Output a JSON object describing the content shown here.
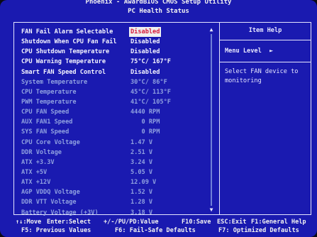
{
  "header": {
    "title": "Phoenix - AwardBIOS CMOS Setup Utility",
    "subtitle": "PC Health Status"
  },
  "settings": [
    {
      "label": "FAN Fail Alarm Selectable",
      "value": "Disabled",
      "editable": true,
      "selected": true
    },
    {
      "label": "Shutdown When CPU Fan Fail",
      "value": "Disabled",
      "editable": true
    },
    {
      "label": "CPU Shutdown Temperature",
      "value": "Disabled",
      "editable": true
    },
    {
      "label": "CPU Warning Temperature",
      "value": "75°C/ 167°F",
      "editable": true
    },
    {
      "label": "Smart FAN Speed Control",
      "value": "Disabled",
      "editable": true
    },
    {
      "label": "System Temperature",
      "value": "30°C/  86°F",
      "editable": false
    },
    {
      "label": "CPU Temperature",
      "value": "45°C/ 113°F",
      "editable": false
    },
    {
      "label": "PWM Temperature",
      "value": "41°C/ 105°F",
      "editable": false
    },
    {
      "label": "CPU FAN Speed",
      "value": "4440 RPM",
      "editable": false
    },
    {
      "label": "AUX FAN1 Speed",
      "value": "   0 RPM",
      "editable": false
    },
    {
      "label": "SYS FAN Speed",
      "value": "   0 RPM",
      "editable": false
    },
    {
      "label": "CPU Core Voltage",
      "value": "1.47 V",
      "editable": false
    },
    {
      "label": "DDR Voltage",
      "value": "2.51 V",
      "editable": false
    },
    {
      "label": "ATX +3.3V",
      "value": "3.24 V",
      "editable": false
    },
    {
      "label": "ATX +5V",
      "value": "5.05 V",
      "editable": false
    },
    {
      "label": "ATX +12V",
      "value": "12.09 V",
      "editable": false
    },
    {
      "label": "AGP VDDQ Voltage",
      "value": "1.52 V",
      "editable": false
    },
    {
      "label": "DDR VTT Voltage",
      "value": "1.28 V",
      "editable": false
    },
    {
      "label": "Battery Voltage (+3V)",
      "value": "3.18 V",
      "editable": false
    }
  ],
  "help": {
    "title": "Item Help",
    "menu_level": "Menu Level",
    "menu_level_arrow": "►",
    "text": "Select FAN device to monitoring"
  },
  "scroll": {
    "up": "▲",
    "down": "▼"
  },
  "keys": {
    "line1": [
      "↑↓:Move",
      "Enter:Select",
      "+/-/PU/PD:Value",
      "F10:Save",
      "ESC:Exit",
      "F1:General Help"
    ],
    "line2": [
      "F5: Previous Values",
      "F6: Fail-Safe Defaults",
      "F7: Optimized Defaults"
    ]
  },
  "colors": {
    "background": "#1a1ab0",
    "text": "#e8ecf8",
    "readonly_text": "#8fa0e0",
    "selected_bg": "#f0f0f0",
    "selected_text": "#d61a3a"
  }
}
